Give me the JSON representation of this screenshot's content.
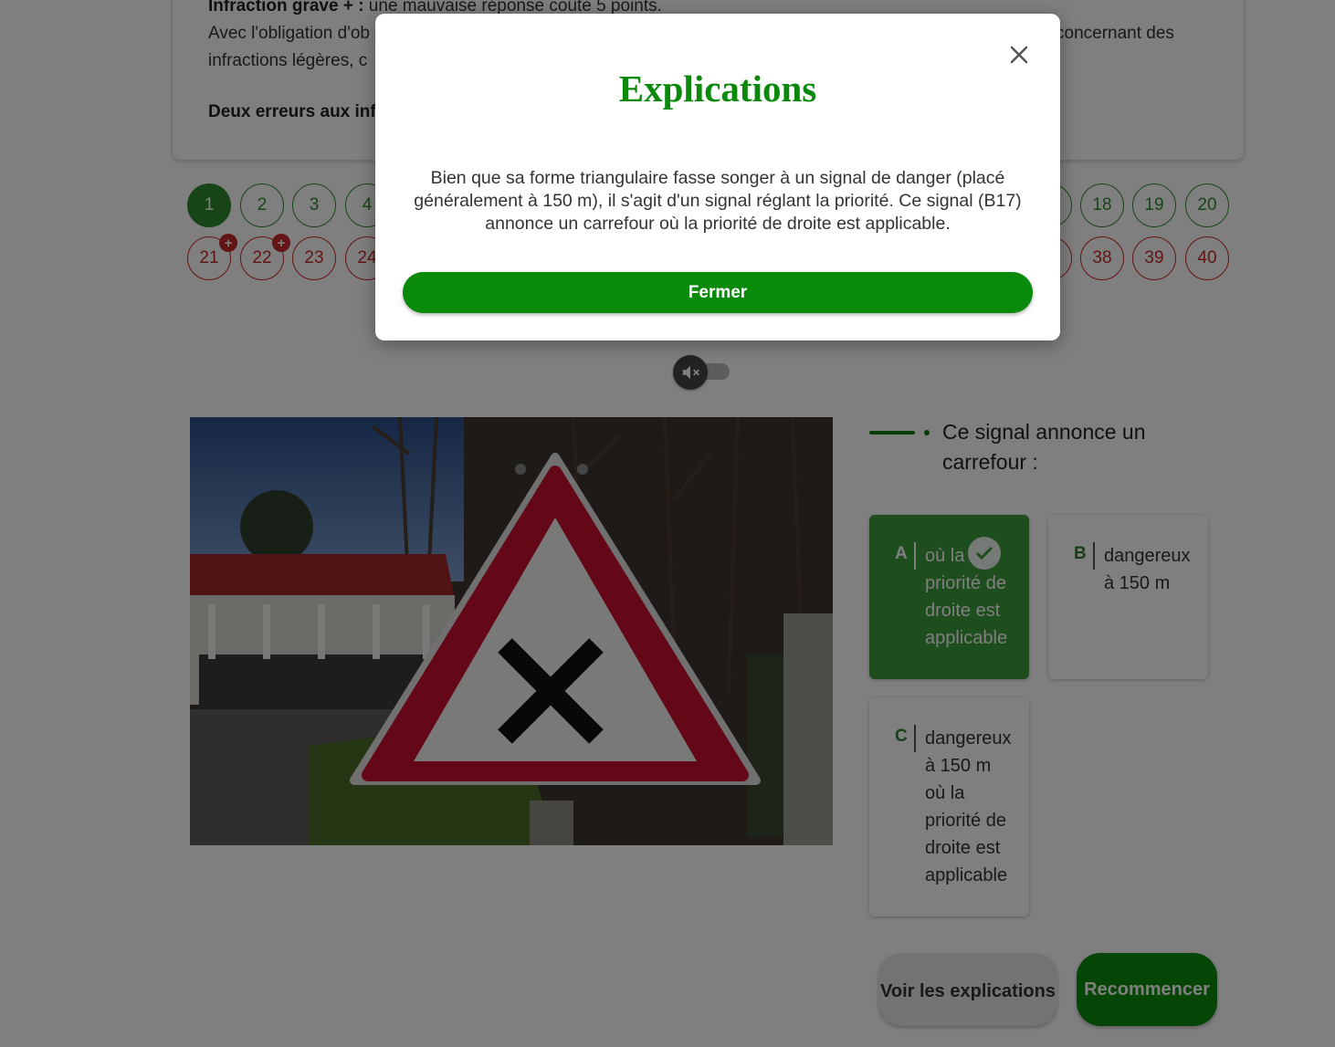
{
  "info": {
    "line1_bold": "Infraction grave + :",
    "line1_rest": " une mauvaise réponse coûte 5 points.",
    "line2_start": "Avec l'obligation d'ob",
    "line2_end": "concernant des",
    "line2b": "infractions légères, c",
    "line3_bold": "Deux erreurs aux inf"
  },
  "question_numbers": {
    "row1": [
      "1",
      "2",
      "3",
      "4",
      "18",
      "19",
      "20"
    ],
    "row2": [
      "21",
      "22",
      "23",
      "24",
      "38",
      "39",
      "40"
    ]
  },
  "question": {
    "text": "Ce signal annonce un carrefour :",
    "answers": [
      {
        "letter": "A",
        "text": "où la priorité de droite est applicable",
        "correct": true
      },
      {
        "letter": "B",
        "text": "dangereux à 150 m",
        "correct": false
      },
      {
        "letter": "C",
        "text": "dangereux à 150 m où la priorité de droite est applicable",
        "correct": false
      }
    ]
  },
  "buttons": {
    "explain": "Voir les explications",
    "restart": "Recommencer"
  },
  "modal": {
    "title": "Explications",
    "body": "Bien que sa forme triangulaire fasse songer à un signal de danger (placé généralement à 150 m), il s'agit d'un signal réglant la priorité. Ce signal (B17) annonce un carrefour où la priorité de droite est applicable.",
    "close_button": "Fermer"
  },
  "colors": {
    "green": "#0a8a0a",
    "red": "#c62828",
    "correct_bg": "#3d9b3d"
  }
}
